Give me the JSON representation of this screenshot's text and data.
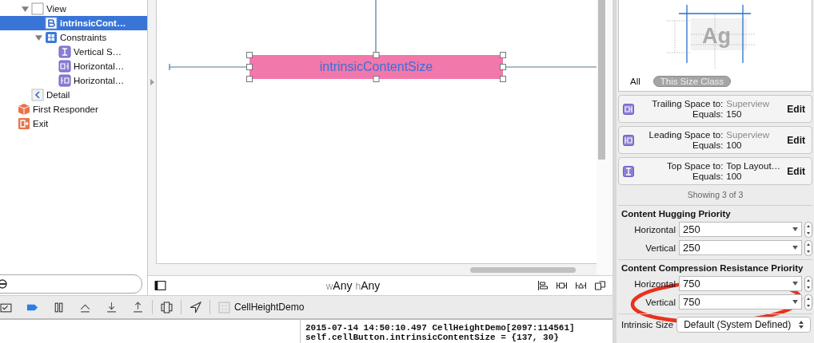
{
  "outline": {
    "scene_children": [
      {
        "label": "View",
        "kind": "view",
        "expanded": true,
        "selected": false,
        "children": [
          {
            "label": "intrinsicCont…",
            "kind": "button",
            "selected": true
          },
          {
            "label": "Constraints",
            "kind": "constraints",
            "expanded": true,
            "selected": false,
            "children": [
              {
                "label": "Vertical S…",
                "kind": "top",
                "selected": false
              },
              {
                "label": "Horizontal…",
                "kind": "trailing",
                "selected": false
              },
              {
                "label": "Horizontal…",
                "kind": "leading",
                "selected": false
              }
            ]
          }
        ]
      },
      {
        "label": "Detail",
        "kind": "back",
        "selected": false
      }
    ],
    "items": [
      {
        "label": "First Responder",
        "kind": "responder",
        "selected": false
      },
      {
        "label": "Exit",
        "kind": "exit",
        "selected": false
      }
    ]
  },
  "canvas": {
    "button_title": "intrinsicContentSize",
    "size_class": [
      {
        "prefix": "w",
        "value": "Any"
      },
      {
        "prefix": "h",
        "value": "Any"
      }
    ]
  },
  "debug_bar": {
    "target": "CellHeightDemo"
  },
  "console": {
    "lines": [
      "2015-07-14 14:50:10.497 CellHeightDemo[2097:114561]",
      "self.cellButton.intrinsicContentSize = {137, 30}"
    ]
  },
  "inspector": {
    "preview": {
      "sample": "Ag"
    },
    "scope_tabs": [
      {
        "label": "All",
        "selected": false
      },
      {
        "label": "This Size Class",
        "selected": true
      }
    ],
    "constraints": [
      {
        "kind": "trailing",
        "label": "Trailing Space to:",
        "target": "Superview",
        "target_dimmed": true,
        "equals_label": "Equals:",
        "value": "150",
        "action": "Edit"
      },
      {
        "kind": "leading",
        "label": "Leading Space to:",
        "target": "Superview",
        "target_dimmed": true,
        "equals_label": "Equals:",
        "value": "100",
        "action": "Edit"
      },
      {
        "kind": "top",
        "label": "Top Space to:",
        "target": "Top Layout…",
        "target_dimmed": false,
        "equals_label": "Equals:",
        "value": "100",
        "action": "Edit"
      }
    ],
    "showing": "Showing 3 of 3",
    "hugging": {
      "title": "Content Hugging Priority",
      "rows": [
        {
          "label": "Horizontal",
          "value": "250"
        },
        {
          "label": "Vertical",
          "value": "250"
        }
      ]
    },
    "compression": {
      "title": "Content Compression Resistance Priority",
      "rows": [
        {
          "label": "Horizontal",
          "value": "750"
        },
        {
          "label": "Vertical",
          "value": "750"
        }
      ]
    },
    "intrinsic_size": {
      "label": "Intrinsic Size",
      "value": "Default (System Defined)"
    }
  }
}
